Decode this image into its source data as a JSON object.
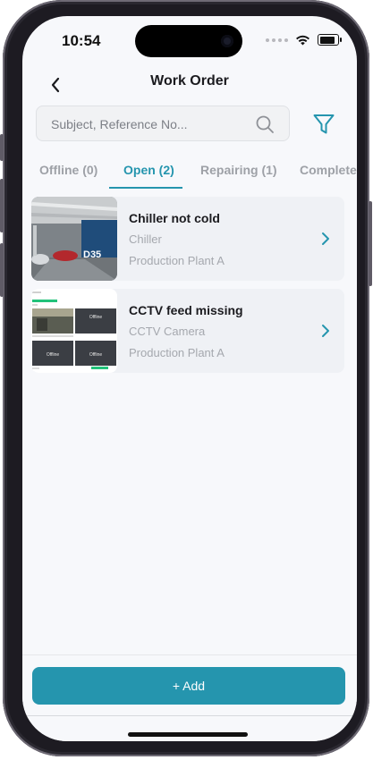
{
  "status_bar": {
    "time": "10:54"
  },
  "header": {
    "title": "Work Order"
  },
  "search": {
    "placeholder": "Subject, Reference No..."
  },
  "tabs": [
    {
      "label": "Offline (0)"
    },
    {
      "label": "Open (2)"
    },
    {
      "label": "Repairing (1)"
    },
    {
      "label": "Complete"
    }
  ],
  "work_orders": [
    {
      "title": "Chiller not cold",
      "equipment": "Chiller",
      "location": "Production Plant A",
      "thumb_label": "D35"
    },
    {
      "title": "CCTV feed missing",
      "equipment": "CCTV Camera",
      "location": "Production Plant A",
      "thumb_label_1": "Offline",
      "thumb_label_2": "Offline",
      "thumb_label_3": "Offline"
    }
  ],
  "footer": {
    "add_label": "+ Add"
  },
  "colors": {
    "accent": "#2595ae",
    "background": "#f7f8fb",
    "card": "#eff1f5"
  }
}
